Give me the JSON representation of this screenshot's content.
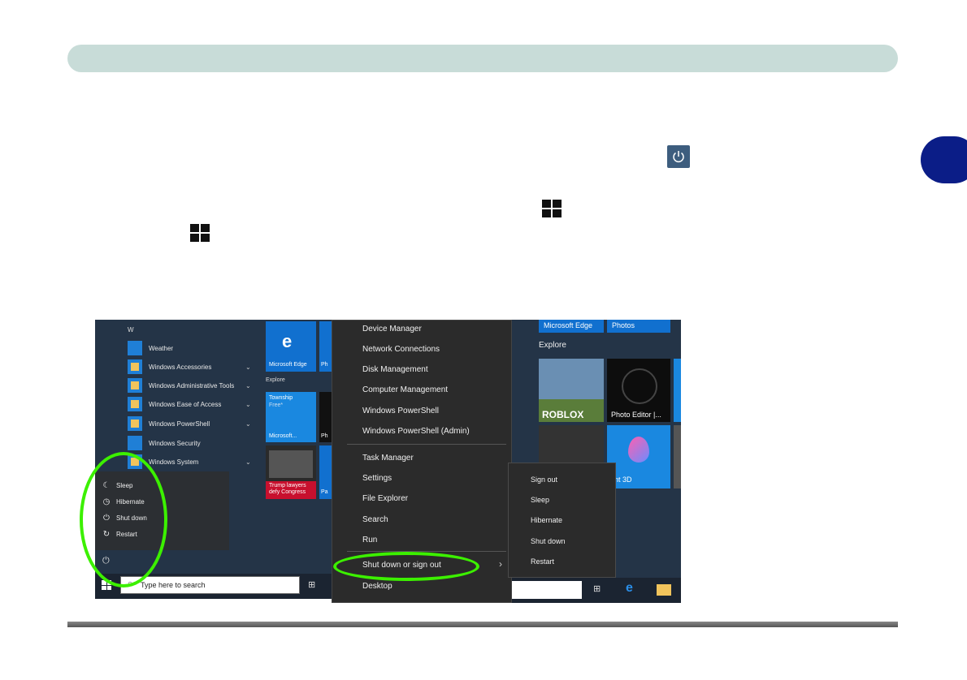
{
  "start_menu": {
    "section_letter": "W",
    "apps": [
      {
        "label": "Weather",
        "icon": "sun-icon",
        "chevron": ""
      },
      {
        "label": "Windows Accessories",
        "icon": "folder-icon",
        "chevron": "⌄"
      },
      {
        "label": "Windows Administrative Tools",
        "icon": "folder-icon",
        "chevron": "⌄"
      },
      {
        "label": "Windows Ease of Access",
        "icon": "folder-icon",
        "chevron": "⌄"
      },
      {
        "label": "Windows PowerShell",
        "icon": "folder-icon",
        "chevron": "⌄"
      },
      {
        "label": "Windows Security",
        "icon": "shield-icon",
        "chevron": ""
      },
      {
        "label": "Windows System",
        "icon": "folder-icon",
        "chevron": "⌄"
      }
    ],
    "power_menu": [
      {
        "label": "Sleep",
        "icon": "moon-icon"
      },
      {
        "label": "Hibernate",
        "icon": "clock-icon"
      },
      {
        "label": "Shut down",
        "icon": "power-icon"
      },
      {
        "label": "Restart",
        "icon": "restart-icon"
      }
    ],
    "search_placeholder": "Type here to search",
    "tiles": {
      "edge": "Microsoft Edge",
      "explore": "Explore",
      "township": "Township",
      "township_sub": "Free*",
      "microsoft_store": "Microsoft...",
      "news": "Trump lawyers defy Congress",
      "ph1": "Ph",
      "ph2": "Ph",
      "pa": "Pa"
    }
  },
  "context_menu": {
    "items_top": [
      "Device Manager",
      "Network Connections",
      "Disk Management",
      "Computer Management",
      "Windows PowerShell",
      "Windows PowerShell (Admin)"
    ],
    "items_bottom": [
      "Task Manager",
      "Settings",
      "File Explorer",
      "Search",
      "Run"
    ],
    "shutdown_item": "Shut down or sign out",
    "desktop_item": "Desktop",
    "submenu": [
      "Sign out",
      "Sleep",
      "Hibernate",
      "Shut down",
      "Restart"
    ]
  },
  "right_tiles": {
    "edge": "Microsoft Edge",
    "photos": "Photos",
    "explore": "Explore",
    "roblox": "ROBLOX",
    "photo_editor": "Photo Editor |...",
    "paint3d": "aint 3D"
  },
  "colors": {
    "highlight_ring": "#3cf000",
    "chapter_tab": "#0b1d87",
    "header_bar": "#c8dcd8"
  }
}
